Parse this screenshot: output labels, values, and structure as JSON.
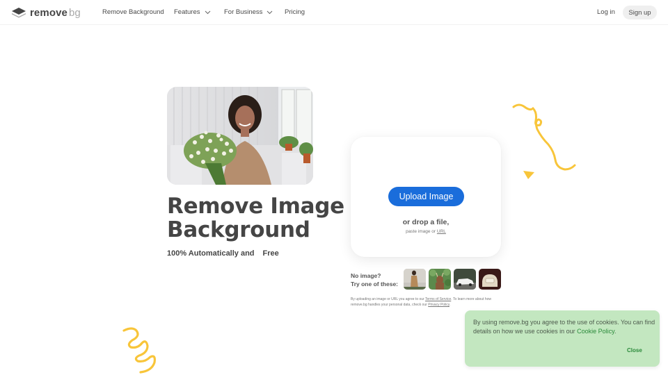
{
  "brand": {
    "name_primary": "remove",
    "name_secondary": "bg"
  },
  "nav": {
    "items": [
      {
        "label": "Remove Background",
        "dropdown": false
      },
      {
        "label": "Features",
        "dropdown": true
      },
      {
        "label": "For Business",
        "dropdown": true
      },
      {
        "label": "Pricing",
        "dropdown": false
      }
    ],
    "login_label": "Log in",
    "signup_label": "Sign up"
  },
  "hero": {
    "image_alt": "Smiling woman holding a bouquet of white flowers",
    "title_line1": "Remove Image",
    "title_line2": "Background",
    "subtitle": "100% Automatically and",
    "badge": "Free",
    "badge_color": "#f8c53a"
  },
  "upload": {
    "button_label": "Upload Image",
    "button_color": "#1a6ddb",
    "drop_text": "or drop a file,",
    "paste_text": "paste image or",
    "url_link": "URL"
  },
  "samples": {
    "line1": "No image?",
    "line2": "Try one of these:",
    "thumbnails": [
      {
        "name": "woman-in-coat"
      },
      {
        "name": "deer-in-foliage"
      },
      {
        "name": "white-car"
      },
      {
        "name": "vintage-phone"
      }
    ]
  },
  "legal": {
    "part1": "By uploading an image or URL you agree to our",
    "terms_link": "Terms of Service",
    "part2": ". To learn more about how remove.bg handles your personal data, check our",
    "privacy_link": "Privacy Policy",
    "part3": "."
  },
  "cookie": {
    "text": "By using remove.bg you agree to the use of cookies. You can find details on how we use cookies in our",
    "link": "Cookie Policy",
    "period": ".",
    "close_label": "Close",
    "background": "#c3e7c0"
  },
  "decoration_color": "#f8c53a"
}
